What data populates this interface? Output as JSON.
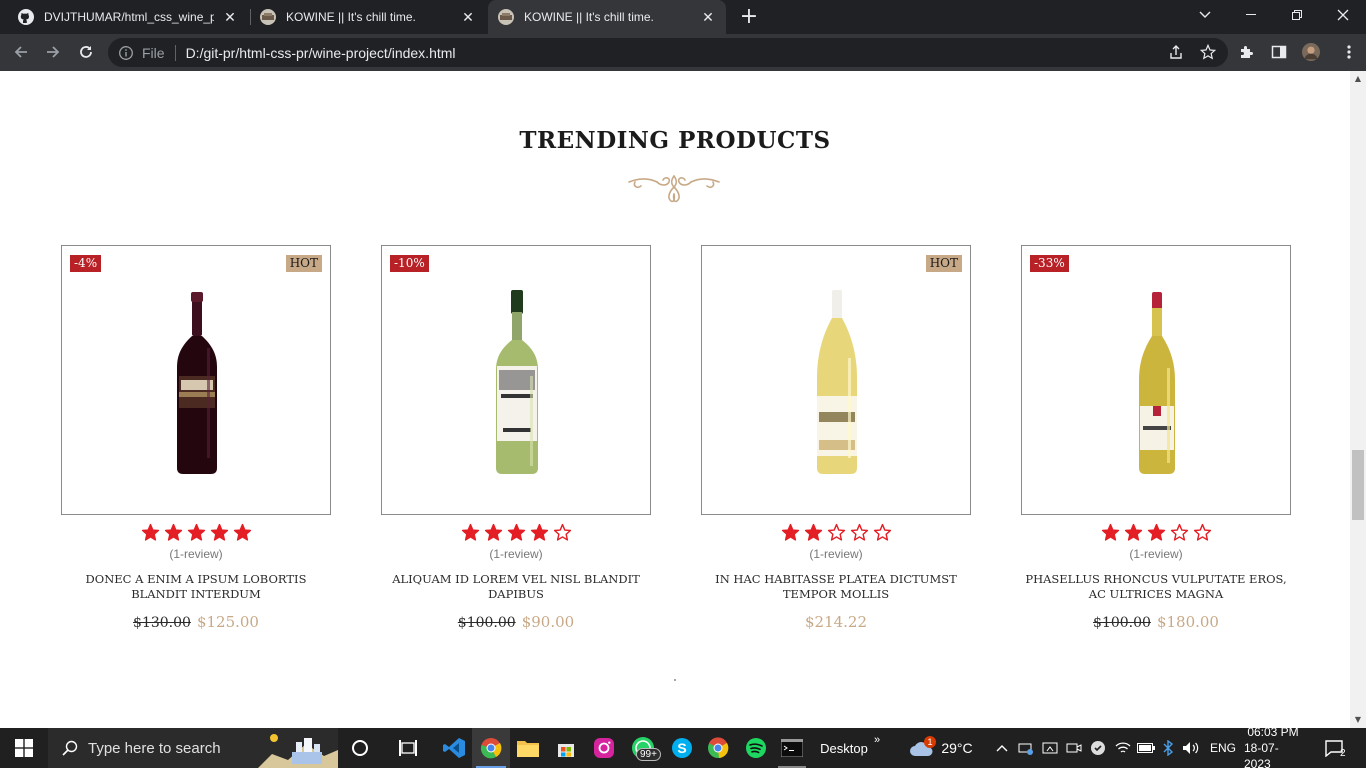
{
  "browser": {
    "tabs": [
      {
        "title": "DVIJTHUMAR/html_css_wine_pro",
        "icon": "github-icon",
        "active": false
      },
      {
        "title": "KOWINE || It's chill time.",
        "icon": "kowine-favicon",
        "active": false
      },
      {
        "title": "KOWINE || It's chill time.",
        "icon": "kowine-favicon",
        "active": true
      }
    ],
    "new_tab": "+",
    "address": {
      "scheme": "File",
      "url": "D:/git-pr/html-css-pr/wine-project/index.html"
    }
  },
  "section": {
    "title": "TRENDING PRODUCTS"
  },
  "products": [
    {
      "discount": "-4%",
      "hot": "HOT",
      "rating": 5,
      "reviews": "(1-review)",
      "name": "DONEC A ENIM A IPSUM LOBORTIS BLANDIT INTERDUM",
      "old_price": "$130.00",
      "price": "$125.00",
      "bottle": "red"
    },
    {
      "discount": "-10%",
      "hot": "",
      "rating": 4,
      "reviews": "(1-review)",
      "name": "ALIQUAM ID LOREM VEL NISL BLANDIT DAPIBUS",
      "old_price": "$100.00",
      "price": "$90.00",
      "bottle": "green"
    },
    {
      "discount": "",
      "hot": "HOT",
      "rating": 2,
      "reviews": "(1-review)",
      "name": "IN HAC HABITASSE PLATEA DICTUMST TEMPOR MOLLIS",
      "old_price": "",
      "price": "$214.22",
      "bottle": "white"
    },
    {
      "discount": "-33%",
      "hot": "",
      "rating": 3,
      "reviews": "(1-review)",
      "name": "PHASELLUS RHONCUS VULPUTATE EROS, AC ULTRICES MAGNA",
      "old_price": "$100.00",
      "price": "$180.00",
      "bottle": "riesling"
    }
  ],
  "colors": {
    "accent_gold": "#c8a987",
    "sale_red": "#b82126",
    "star_red": "#e31e24"
  },
  "taskbar": {
    "search_placeholder": "Type here to search",
    "desktop_label": "Desktop",
    "weather": "29°C",
    "language": "ENG",
    "time": "06:03 PM",
    "date": "18-07-2023",
    "whatsapp_badge": "99+",
    "weather_badge": "1",
    "notification_count": "2"
  }
}
